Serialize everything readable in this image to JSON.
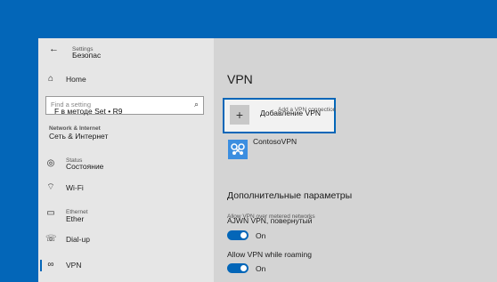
{
  "sidebar": {
    "back_icon": "back-arrow-icon",
    "settings_label": "Settings",
    "settings_overlay": "Безопас",
    "home_label": "Home",
    "search_placeholder": "Find a setting",
    "search_overlay": "F в методе Set • R9",
    "category_label": "Network & Internet",
    "category_overlay": "Сеть & Интернет",
    "items": [
      {
        "label": "Status",
        "overlay": "Состояние",
        "icon": "status-icon"
      },
      {
        "label": "Wi-Fi",
        "overlay": "",
        "icon": "wifi-icon"
      },
      {
        "label": "Ethernet",
        "overlay": "Ether",
        "icon": "ethernet-icon"
      },
      {
        "label": "Dial-up",
        "overlay": "",
        "icon": "dialup-icon"
      },
      {
        "label": "VPN",
        "overlay": "",
        "icon": "vpn-icon"
      }
    ],
    "active_item": "VPN"
  },
  "main": {
    "title": "VPN",
    "add_vpn_label": "Add a VPN connection",
    "add_vpn_overlay": "Добавление VPN",
    "connection_name": "ContosoVPN",
    "advanced_title": "Дополнительные параметры",
    "options": [
      {
        "label": "Allow VPN over metered networks",
        "overlay": "AJWN VPN, повернутый",
        "state": "On"
      },
      {
        "label": "Allow VPN while roaming",
        "overlay": "",
        "state": "On"
      }
    ]
  },
  "colors": {
    "accent": "#0366b8",
    "desktop": "#0366b8",
    "sidebar_bg": "#e6e6e6",
    "main_bg": "#d4d4d4",
    "vpn_icon_bg": "#3b8ee0"
  }
}
